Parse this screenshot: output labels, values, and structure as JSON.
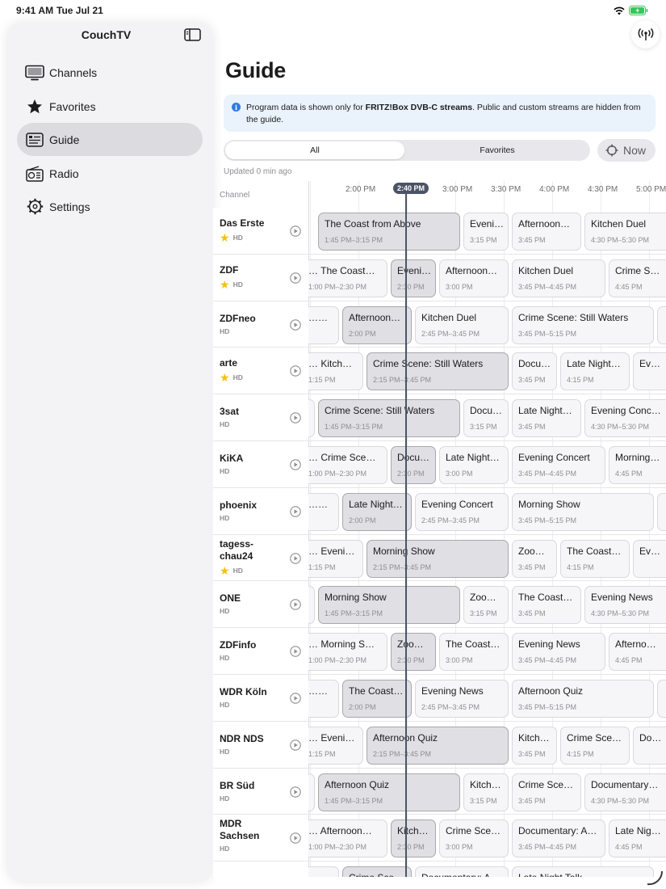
{
  "status_bar": {
    "time": "9:41 AM",
    "date": "Tue Jul 21"
  },
  "sidebar": {
    "title": "CouchTV",
    "items": [
      {
        "label": "Channels",
        "icon": "tv-icon"
      },
      {
        "label": "Favorites",
        "icon": "star-icon"
      },
      {
        "label": "Guide",
        "icon": "guide-icon",
        "active": true
      },
      {
        "label": "Radio",
        "icon": "radio-icon"
      },
      {
        "label": "Settings",
        "icon": "gear-icon"
      }
    ]
  },
  "page": {
    "title": "Guide"
  },
  "info": {
    "text_before": "Program data is shown only for ",
    "text_bold": "FRITZ!Box DVB-C streams",
    "text_after": ". Public and custom streams are hidden from the guide."
  },
  "filter": {
    "options": [
      "All",
      "Favorites"
    ],
    "selected": "All"
  },
  "now_button": {
    "label": "Now"
  },
  "updated": "Updated 0 min ago",
  "guide": {
    "channel_header": "Channel",
    "times": [
      "2:00 PM",
      "2:30 PM",
      "3:00 PM",
      "3:30 PM",
      "4:00 PM",
      "4:30 PM",
      "5:00 PM"
    ],
    "now_label": "2:40 PM",
    "hd_label": "HD",
    "accent_color": "#4b5466",
    "star_color": "#f4c10f",
    "channels": [
      {
        "name": "Das Erste",
        "favorite": true,
        "programs": [
          {
            "title": "The Coast from Above",
            "time": "1:45 PM–3:15 PM",
            "start": "13:45",
            "end": "15:15"
          },
          {
            "title": "Eveni…",
            "time": "3:15 PM",
            "start": "15:15",
            "end": "15:45"
          },
          {
            "title": "Afternoon…",
            "time": "3:45 PM",
            "start": "15:45",
            "end": "16:30"
          },
          {
            "title": "Kitchen Duel",
            "time": "4:30 PM–5:30 PM",
            "start": "16:30",
            "end": "17:30"
          }
        ]
      },
      {
        "name": "ZDF",
        "favorite": true,
        "programs": [
          {
            "title": "… The Coast…",
            "time": "1:00 PM–2:30 PM",
            "start": "13:00",
            "end": "14:30"
          },
          {
            "title": "Eveni…",
            "time": "2:30 PM",
            "start": "14:30",
            "end": "15:00"
          },
          {
            "title": "Afternoon…",
            "time": "3:00 PM",
            "start": "15:00",
            "end": "15:45"
          },
          {
            "title": "Kitchen Duel",
            "time": "3:45 PM–4:45 PM",
            "start": "15:45",
            "end": "16:45"
          },
          {
            "title": "Crime S…",
            "time": "4:45 PM",
            "start": "16:45",
            "end": "17:30"
          }
        ]
      },
      {
        "name": "ZDFneo",
        "favorite": false,
        "programs": [
          {
            "title": "……",
            "time": "",
            "start": "13:00",
            "end": "14:00"
          },
          {
            "title": "Afternoon…",
            "time": "2:00 PM",
            "start": "14:00",
            "end": "14:45"
          },
          {
            "title": "Kitchen Duel",
            "time": "2:45 PM–3:45 PM",
            "start": "14:45",
            "end": "15:45"
          },
          {
            "title": "Crime Scene: Still Waters",
            "time": "3:45 PM–5:15 PM",
            "start": "15:45",
            "end": "17:15"
          },
          {
            "title": "",
            "time": "",
            "start": "17:15",
            "end": "18:00"
          }
        ]
      },
      {
        "name": "arte",
        "favorite": true,
        "programs": [
          {
            "title": "… Kitch…",
            "time": "1:15 PM",
            "start": "13:15",
            "end": "14:15"
          },
          {
            "title": "Crime Scene: Still Waters",
            "time": "2:15 PM–3:45 PM",
            "start": "14:15",
            "end": "15:45"
          },
          {
            "title": "Docu…",
            "time": "3:45 PM",
            "start": "15:45",
            "end": "16:15"
          },
          {
            "title": "Late Night…",
            "time": "4:15 PM",
            "start": "16:15",
            "end": "17:00"
          },
          {
            "title": "Ev…",
            "time": "",
            "start": "17:00",
            "end": "17:45"
          }
        ]
      },
      {
        "name": "3sat",
        "favorite": false,
        "programs": [
          {
            "title": "",
            "time": "",
            "start": "13:00",
            "end": "13:45"
          },
          {
            "title": "Crime Scene: Still Waters",
            "time": "1:45 PM–3:15 PM",
            "start": "13:45",
            "end": "15:15"
          },
          {
            "title": "Docu…",
            "time": "3:15 PM",
            "start": "15:15",
            "end": "15:45"
          },
          {
            "title": "Late Night…",
            "time": "3:45 PM",
            "start": "15:45",
            "end": "16:30"
          },
          {
            "title": "Evening Conc…",
            "time": "4:30 PM–5:30 PM",
            "start": "16:30",
            "end": "17:30"
          }
        ]
      },
      {
        "name": "KiKA",
        "favorite": false,
        "programs": [
          {
            "title": "… Crime Sce…",
            "time": "1:00 PM–2:30 PM",
            "start": "13:00",
            "end": "14:30"
          },
          {
            "title": "Docu…",
            "time": "2:30 PM",
            "start": "14:30",
            "end": "15:00"
          },
          {
            "title": "Late Night…",
            "time": "3:00 PM",
            "start": "15:00",
            "end": "15:45"
          },
          {
            "title": "Evening Concert",
            "time": "3:45 PM–4:45 PM",
            "start": "15:45",
            "end": "16:45"
          },
          {
            "title": "Morning…",
            "time": "4:45 PM",
            "start": "16:45",
            "end": "17:30"
          }
        ]
      },
      {
        "name": "phoenix",
        "favorite": false,
        "programs": [
          {
            "title": "……",
            "time": "",
            "start": "13:00",
            "end": "14:00"
          },
          {
            "title": "Late Night…",
            "time": "2:00 PM",
            "start": "14:00",
            "end": "14:45"
          },
          {
            "title": "Evening Concert",
            "time": "2:45 PM–3:45 PM",
            "start": "14:45",
            "end": "15:45"
          },
          {
            "title": "Morning Show",
            "time": "3:45 PM–5:15 PM",
            "start": "15:45",
            "end": "17:15"
          },
          {
            "title": "",
            "time": "",
            "start": "17:15",
            "end": "18:00"
          }
        ]
      },
      {
        "name": "tagess-\nchau24",
        "favorite": true,
        "programs": [
          {
            "title": "… Eveni…",
            "time": "1:15 PM",
            "start": "13:15",
            "end": "14:15"
          },
          {
            "title": "Morning Show",
            "time": "2:15 PM–3:45 PM",
            "start": "14:15",
            "end": "15:45"
          },
          {
            "title": "Zoo…",
            "time": "3:45 PM",
            "start": "15:45",
            "end": "16:15"
          },
          {
            "title": "The Coast…",
            "time": "4:15 PM",
            "start": "16:15",
            "end": "17:00"
          },
          {
            "title": "Ev…",
            "time": "",
            "start": "17:00",
            "end": "17:45"
          }
        ]
      },
      {
        "name": "ONE",
        "favorite": false,
        "programs": [
          {
            "title": "",
            "time": "",
            "start": "13:00",
            "end": "13:45"
          },
          {
            "title": "Morning Show",
            "time": "1:45 PM–3:15 PM",
            "start": "13:45",
            "end": "15:15"
          },
          {
            "title": "Zoo…",
            "time": "3:15 PM",
            "start": "15:15",
            "end": "15:45"
          },
          {
            "title": "The Coast…",
            "time": "3:45 PM",
            "start": "15:45",
            "end": "16:30"
          },
          {
            "title": "Evening News",
            "time": "4:30 PM–5:30 PM",
            "start": "16:30",
            "end": "17:30"
          }
        ]
      },
      {
        "name": "ZDFinfo",
        "favorite": false,
        "programs": [
          {
            "title": "… Morning S…",
            "time": "1:00 PM–2:30 PM",
            "start": "13:00",
            "end": "14:30"
          },
          {
            "title": "Zoo…",
            "time": "2:30 PM",
            "start": "14:30",
            "end": "15:00"
          },
          {
            "title": "The Coast…",
            "time": "3:00 PM",
            "start": "15:00",
            "end": "15:45"
          },
          {
            "title": "Evening News",
            "time": "3:45 PM–4:45 PM",
            "start": "15:45",
            "end": "16:45"
          },
          {
            "title": "Afterno…",
            "time": "4:45 PM",
            "start": "16:45",
            "end": "17:30"
          }
        ]
      },
      {
        "name": "WDR Köln",
        "favorite": false,
        "programs": [
          {
            "title": "……",
            "time": "",
            "start": "13:00",
            "end": "14:00"
          },
          {
            "title": "The Coast…",
            "time": "2:00 PM",
            "start": "14:00",
            "end": "14:45"
          },
          {
            "title": "Evening News",
            "time": "2:45 PM–3:45 PM",
            "start": "14:45",
            "end": "15:45"
          },
          {
            "title": "Afternoon Quiz",
            "time": "3:45 PM–5:15 PM",
            "start": "15:45",
            "end": "17:15"
          },
          {
            "title": "",
            "time": "",
            "start": "17:15",
            "end": "18:00"
          }
        ]
      },
      {
        "name": "NDR NDS",
        "favorite": false,
        "programs": [
          {
            "title": "… Eveni…",
            "time": "1:15 PM",
            "start": "13:15",
            "end": "14:15"
          },
          {
            "title": "Afternoon Quiz",
            "time": "2:15 PM–3:45 PM",
            "start": "14:15",
            "end": "15:45"
          },
          {
            "title": "Kitch…",
            "time": "3:45 PM",
            "start": "15:45",
            "end": "16:15"
          },
          {
            "title": "Crime Sce…",
            "time": "4:15 PM",
            "start": "16:15",
            "end": "17:00"
          },
          {
            "title": "Do…",
            "time": "",
            "start": "17:00",
            "end": "17:45"
          }
        ]
      },
      {
        "name": "BR Süd",
        "favorite": false,
        "programs": [
          {
            "title": "",
            "time": "",
            "start": "13:00",
            "end": "13:45"
          },
          {
            "title": "Afternoon Quiz",
            "time": "1:45 PM–3:15 PM",
            "start": "13:45",
            "end": "15:15"
          },
          {
            "title": "Kitch…",
            "time": "3:15 PM",
            "start": "15:15",
            "end": "15:45"
          },
          {
            "title": "Crime Sce…",
            "time": "3:45 PM",
            "start": "15:45",
            "end": "16:30"
          },
          {
            "title": "Documentary…",
            "time": "4:30 PM–5:30 PM",
            "start": "16:30",
            "end": "17:30"
          }
        ]
      },
      {
        "name": "MDR\nSachsen",
        "favorite": false,
        "programs": [
          {
            "title": "… Afternoon…",
            "time": "1:00 PM–2:30 PM",
            "start": "13:00",
            "end": "14:30"
          },
          {
            "title": "Kitch…",
            "time": "2:30 PM",
            "start": "14:30",
            "end": "15:00"
          },
          {
            "title": "Crime Sce…",
            "time": "3:00 PM",
            "start": "15:00",
            "end": "15:45"
          },
          {
            "title": "Documentary: A…",
            "time": "3:45 PM–4:45 PM",
            "start": "15:45",
            "end": "16:45"
          },
          {
            "title": "Late Nig…",
            "time": "4:45 PM",
            "start": "16:45",
            "end": "17:30"
          }
        ]
      },
      {
        "name": "",
        "favorite": false,
        "programs": [
          {
            "title": "",
            "time": "",
            "start": "13:00",
            "end": "14:00"
          },
          {
            "title": "Crime Sce…",
            "time": "",
            "start": "14:00",
            "end": "14:45"
          },
          {
            "title": "Documentary: A…",
            "time": "",
            "start": "14:45",
            "end": "15:45"
          },
          {
            "title": "Late Night Talk",
            "time": "",
            "start": "15:45",
            "end": "17:15"
          }
        ]
      }
    ]
  }
}
